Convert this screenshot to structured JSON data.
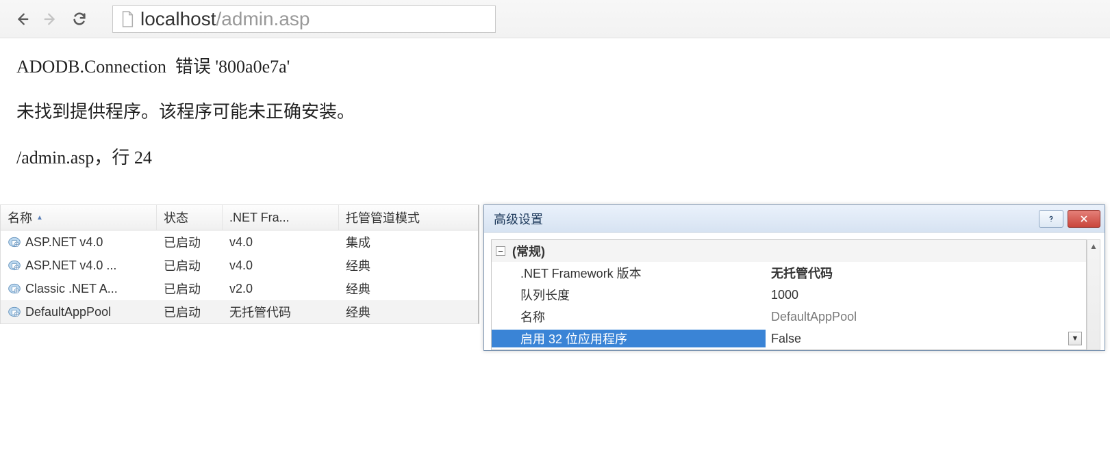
{
  "browser": {
    "url_host": "localhost",
    "url_path": "/admin.asp"
  },
  "error": {
    "object": "ADODB.Connection",
    "error_word": "错误",
    "code": "'800a0e7a'",
    "message": "未找到提供程序。该程序可能未正确安装。",
    "file": "/admin.asp",
    "sep": "，",
    "line_word": "行",
    "line": "24"
  },
  "pool_table": {
    "headers": [
      "名称",
      "状态",
      ".NET Fra...",
      "托管管道模式"
    ],
    "rows": [
      {
        "name": "ASP.NET v4.0",
        "status": "已启动",
        "net": "v4.0",
        "mode": "集成"
      },
      {
        "name": "ASP.NET v4.0 ...",
        "status": "已启动",
        "net": "v4.0",
        "mode": "经典"
      },
      {
        "name": "Classic .NET A...",
        "status": "已启动",
        "net": "v2.0",
        "mode": "经典"
      },
      {
        "name": "DefaultAppPool",
        "status": "已启动",
        "net": "无托管代码",
        "mode": "经典"
      }
    ],
    "selected_index": 3
  },
  "dialog": {
    "title": "高级设置",
    "category": "(常规)",
    "props": [
      {
        "label": ".NET Framework 版本",
        "value": "无托管代码",
        "bold": true
      },
      {
        "label": "队列长度",
        "value": "1000"
      },
      {
        "label": "名称",
        "value": "DefaultAppPool",
        "readonly": true
      },
      {
        "label": "启用 32 位应用程序",
        "value": "False",
        "selected": true,
        "combo": true
      }
    ]
  }
}
